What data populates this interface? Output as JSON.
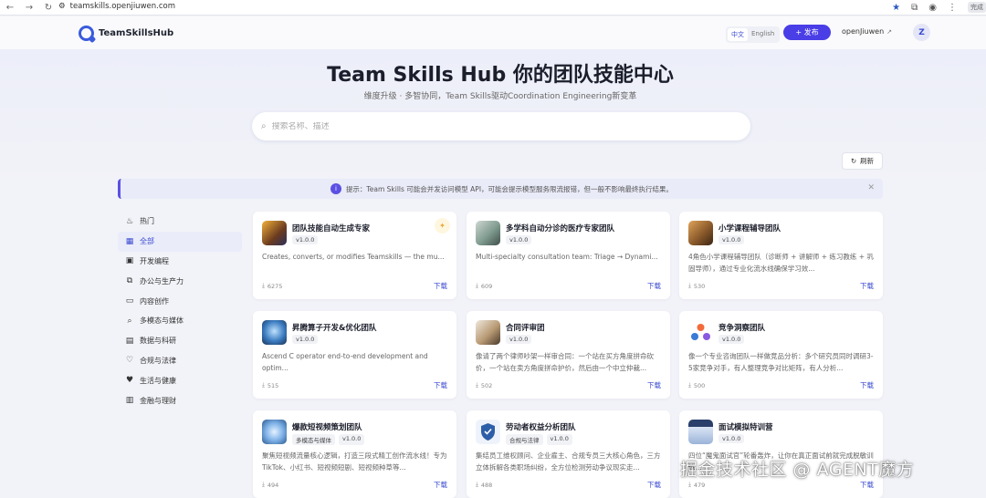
{
  "browser": {
    "url": "teamskills.openjiuwen.com",
    "done_label": "完成"
  },
  "header": {
    "brand": "TeamSkillsHub",
    "lang_zh": "中文",
    "lang_en": "English",
    "publish_label": "+ 发布",
    "user_link": "openJiuwen",
    "avatar_letter": "Z"
  },
  "hero": {
    "title": "Team Skills Hub 你的团队技能中心",
    "subtitle": "维度升级 · 多智协同，Team Skills驱动Coordination Engineering新变革",
    "search_placeholder": "搜索名称、描述"
  },
  "toolbar": {
    "refresh_label": "刷新"
  },
  "notice": {
    "text": "提示：Team Skills 可能会并发访问模型 API，可能会提示模型服务限流报错，但一般不影响最终执行结果。"
  },
  "sidebar": {
    "items": [
      {
        "label": "热门",
        "icon": "fire-icon"
      },
      {
        "label": "全部",
        "icon": "grid-icon"
      },
      {
        "label": "开发编程",
        "icon": "chip-icon"
      },
      {
        "label": "办公与生产力",
        "icon": "layers-icon"
      },
      {
        "label": "内容创作",
        "icon": "book-icon"
      },
      {
        "label": "多模态与媒体",
        "icon": "search-icon"
      },
      {
        "label": "数据与科研",
        "icon": "chart-icon"
      },
      {
        "label": "合规与法律",
        "icon": "shield-icon"
      },
      {
        "label": "生活与健康",
        "icon": "heart-icon"
      },
      {
        "label": "金融与理财",
        "icon": "finance-icon"
      }
    ]
  },
  "cards": [
    {
      "title": "团队技能自动生成专家",
      "tags": [
        "v1.0.0"
      ],
      "desc": "Creates, converts, or modifies Teamskills — the mu...",
      "downloads": "6275",
      "download_label": "下载",
      "favorite": true
    },
    {
      "title": "多学科自动分诊的医疗专家团队",
      "tags": [
        "v1.0.0"
      ],
      "desc": "Multi-specialty consultation team: Triage → Dynami...",
      "downloads": "609",
      "download_label": "下载"
    },
    {
      "title": "小学课程辅导团队",
      "tags": [
        "v1.0.0"
      ],
      "desc": "4角色小学课程辅导团队（诊断师 + 讲解师 + 练习教练 + 巩固导师），通过专业化流水线确保学习效...",
      "downloads": "530",
      "download_label": "下载"
    },
    {
      "title": "昇腾算子开发&优化团队",
      "tags": [
        "v1.0.0"
      ],
      "desc": "Ascend C operator end-to-end development and optim...",
      "downloads": "515",
      "download_label": "下载"
    },
    {
      "title": "合同评审团",
      "tags": [
        "v1.0.0"
      ],
      "desc": "像请了两个律师吵架一样审合同：一个站在买方角度拼命砍价，一个站在卖方角度拼命护价，然后由一个中立仲裁...",
      "downloads": "502",
      "download_label": "下载"
    },
    {
      "title": "竞争洞察团队",
      "tags": [
        "v1.0.0"
      ],
      "desc": "像一个专业咨询团队一样做竞品分析：多个研究员同时调研3-5家竞争对手，有人整理竞争对比矩阵，有人分析...",
      "downloads": "500",
      "download_label": "下载"
    },
    {
      "title": "爆款短视频策划团队",
      "tags": [
        "多模态与媒体",
        "v1.0.0"
      ],
      "desc": "聚焦短视频流量核心逻辑，打造三段式精工创作流水线！专为TikTok、小红书、短视频短剧、短视频种草等...",
      "downloads": "494",
      "download_label": "下载"
    },
    {
      "title": "劳动者权益分析团队",
      "tags": [
        "合规与法律",
        "v1.0.0"
      ],
      "desc": "集结员工维权顾问、企业雇主、合规专员三大核心角色，三方立体拆解各类职场纠纷，全方位检测劳动争议现实走...",
      "downloads": "488",
      "download_label": "下载"
    },
    {
      "title": "面试模拟特训营",
      "tags": [
        "v1.0.0"
      ],
      "desc": "四位“魔鬼面试官”轮番轰炸，让你在真正面试前就完成脱敏训练...",
      "downloads": "479",
      "download_label": "下载"
    }
  ],
  "watermark": "掘金技术社区 @ AGENT魔方"
}
